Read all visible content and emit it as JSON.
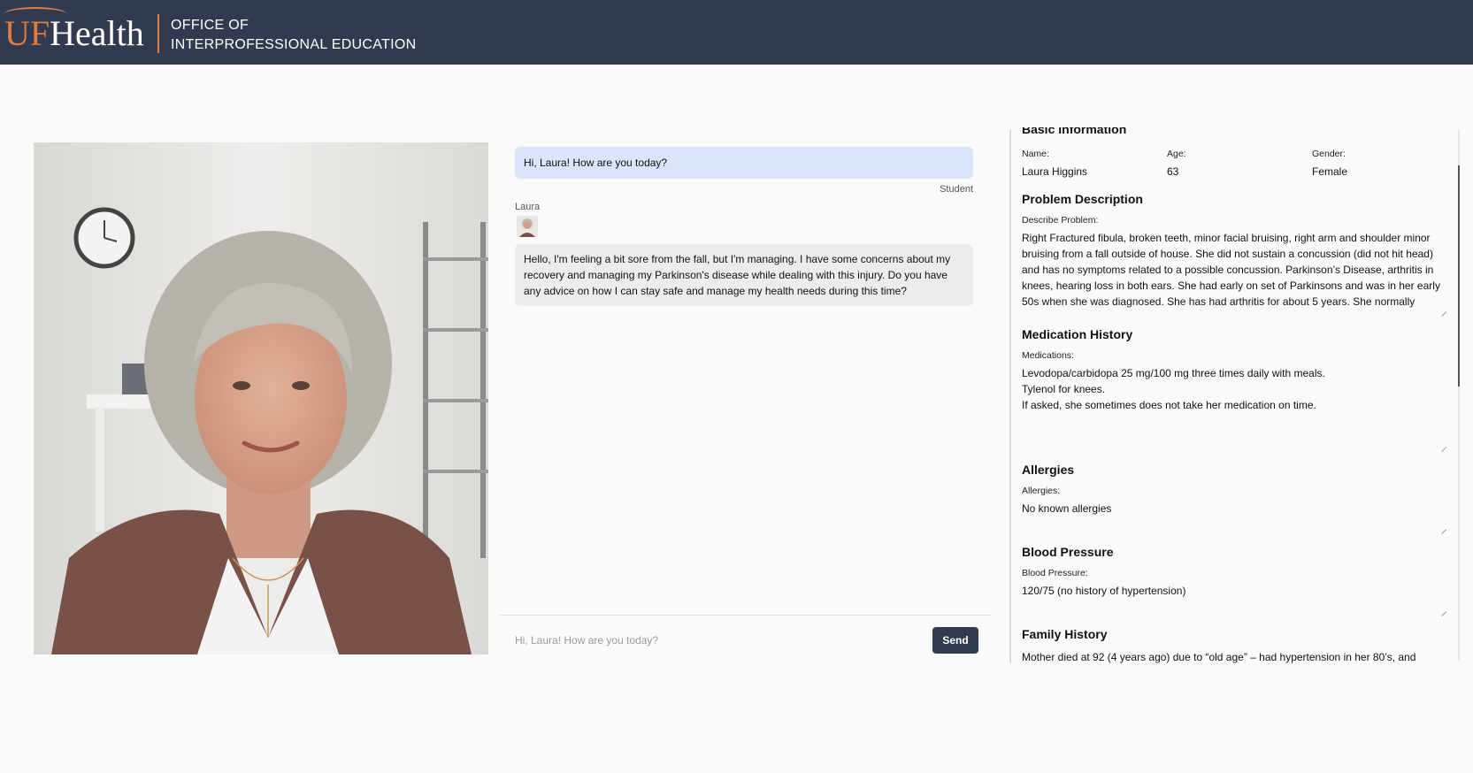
{
  "header": {
    "logo_uf": "UF",
    "logo_health": "Health",
    "office_line1": "OFFICE OF",
    "office_line2": "INTERPROFESSIONAL EDUCATION",
    "bg_color": "#313a50",
    "accent": "#e07d3c"
  },
  "chat": {
    "messages": [
      {
        "sender": "Student",
        "text": "Hi, Laura! How are you today?"
      },
      {
        "sender": "Laura",
        "text": "Hello, I'm feeling a bit sore from the fall, but I'm managing. I have some concerns about my recovery and managing my Parkinson's disease while dealing with this injury. Do you have any advice on how I can stay safe and manage my health needs during this time?"
      }
    ],
    "input_placeholder": "Hi, Laura! How are you today?",
    "send_label": "Send"
  },
  "patient": {
    "basic_heading": "Basic Information",
    "name_label": "Name:",
    "name": "Laura Higgins",
    "age_label": "Age:",
    "age": "63",
    "gender_label": "Gender:",
    "gender": "Female",
    "problem_heading": "Problem Description",
    "problem_label": "Describe Problem:",
    "problem_text": "Right Fractured fibula, broken teeth, minor facial bruising, right arm and shoulder minor bruising from a fall outside of house. She did not sustain a concussion (did not hit head) and has no symptoms related to a possible concussion. Parkinson’s Disease, arthritis in knees, hearing loss in both ears. She had early on set of Parkinsons and was in her early 50s when she was diagnosed. She has had arthritis for about 5 years. She normally",
    "medication_heading": "Medication History",
    "medication_label": "Medications:",
    "medications": [
      "Levodopa/carbidopa 25 mg/100 mg three times daily with meals.",
      "Tylenol for knees.",
      "If asked, she sometimes does not take her medication on time."
    ],
    "allergies_heading": "Allergies",
    "allergies_label": "Allergies:",
    "allergies": "No known allergies",
    "bp_heading": "Blood Pressure",
    "bp_label": "Blood Pressure:",
    "bp": "120/75 (no history of hypertension)",
    "family_heading": "Family History",
    "family_text": "Mother died at 92 (4 years ago) due to “old age” – had hypertension in her 80’s, and"
  }
}
